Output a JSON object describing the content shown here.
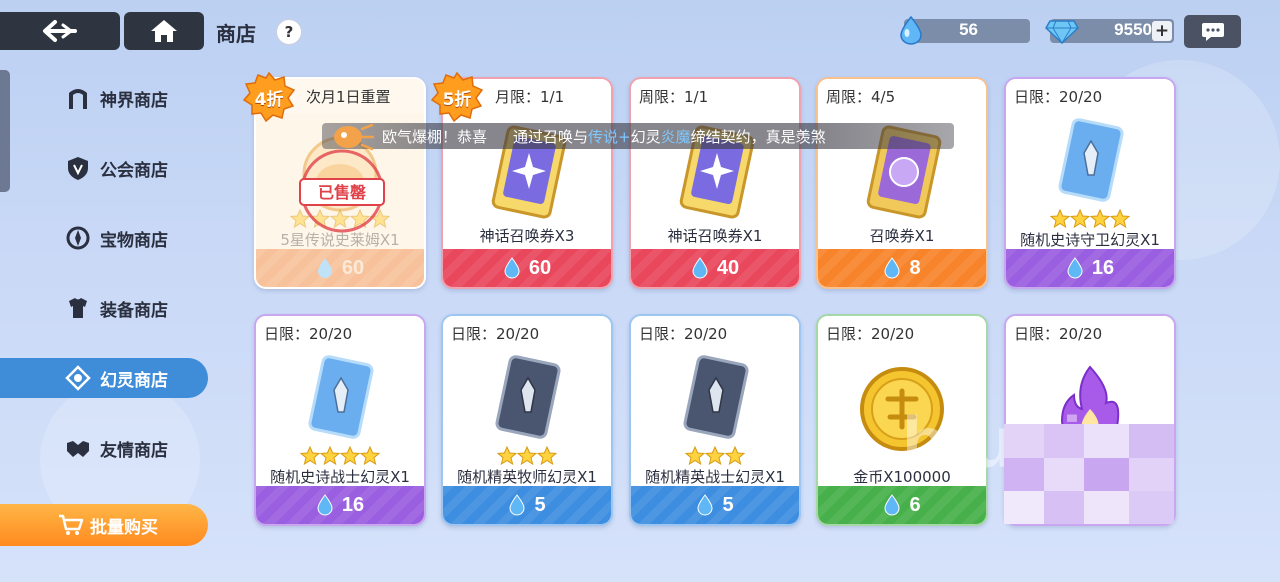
{
  "header": {
    "title": "商店",
    "help_label": "?",
    "currency_drop": "56",
    "currency_gem": "9550",
    "plus_label": "+"
  },
  "sidebar": {
    "items": [
      {
        "label": "神界商店"
      },
      {
        "label": "公会商店"
      },
      {
        "label": "宝物商店"
      },
      {
        "label": "装备商店"
      },
      {
        "label": "幻灵商店",
        "active": true
      },
      {
        "label": "友情商店"
      }
    ],
    "bulk_buy": "批量购买"
  },
  "broadcast": {
    "part1": "欧气爆棚！恭喜",
    "part2": "通过召唤与",
    "part3": "传说+",
    "part4": "幻灵",
    "part5": "炎魔",
    "part6": "缔结契约，真是羡煞"
  },
  "cards": [
    {
      "limit": "次月1日重置",
      "name": "5星传说史莱姆X1",
      "price": "60",
      "discount": "4折",
      "sold_out": "已售罄",
      "stars": 5
    },
    {
      "limit": "月限：1/1",
      "name": "神话召唤券X3",
      "price": "60",
      "discount": "5折"
    },
    {
      "limit": "周限：1/1",
      "name": "神话召唤券X1",
      "price": "40"
    },
    {
      "limit": "周限：4/5",
      "name": "召唤券X1",
      "price": "8"
    },
    {
      "limit": "日限：20/20",
      "name": "随机史诗守卫幻灵X1",
      "price": "16",
      "stars": 4
    },
    {
      "limit": "日限：20/20",
      "name": "随机史诗战士幻灵X1",
      "price": "16",
      "stars": 4
    },
    {
      "limit": "日限：20/20",
      "name": "随机精英牧师幻灵X1",
      "price": "5",
      "stars": 3
    },
    {
      "limit": "日限：20/20",
      "name": "随机精英战士幻灵X1",
      "price": "5",
      "stars": 3
    },
    {
      "limit": "日限：20/20",
      "name": "金币X100000",
      "price": "6"
    },
    {
      "limit": "日限：20/20",
      "name": "",
      "price": ""
    }
  ],
  "watermark": "biubiu",
  "colors": {
    "active_tab": "#3f8cd9",
    "bulk_button": "#ff9a2e",
    "red_band": "#e8475c",
    "orange_band": "#f7842a",
    "purple_band": "#9a5ee0",
    "blue_band": "#3d8de0",
    "green_band": "#47b04a"
  }
}
